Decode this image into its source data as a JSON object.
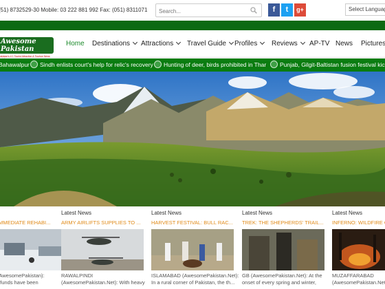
{
  "topbar": {
    "contact": "(51) 8732529-30 Mobile: 03 222 881 992 Fax: (051) 8311071",
    "search_placeholder": "Search...",
    "social": {
      "facebook": "f",
      "twitter": "t",
      "googleplus": "g+"
    },
    "language": "Select Language"
  },
  "logo": {
    "brand": "Awesome Pakistan",
    "tagline": "Pakistan's # 1 Tourist Attraction & Tourism News Portal"
  },
  "nav": {
    "home": "Home",
    "destinations": "Destinations",
    "attractions": "Attractions",
    "travel_guide": "Travel Guide",
    "profiles": "Profiles",
    "reviews": "Reviews",
    "aptv": "AP-TV",
    "news": "News",
    "pictures": "Pictures"
  },
  "ticker": [
    "Bahawalpur",
    "Sindh enlists court's help for relic's recovery",
    "Hunting of deer, birds prohibited in Thar",
    "Punjab, Gilgit-Baltistan fusion festival kicks off"
  ],
  "cards": [
    {
      "label": "",
      "headline": "IMMEDIATE REHABI...",
      "place": "(AwesomePakistan):",
      "snippet": "f funds have been"
    },
    {
      "label": "Latest News",
      "headline": "ARMY AIRLIFTS SUPPLIES TO ...",
      "place": "RAWALPINDI",
      "snippet": "(AwesomePakistan.Net): With heavy"
    },
    {
      "label": "Latest News",
      "headline": "HARVEST FESTIVAL: BULL RAC...",
      "place": "ISLAMABAD (AwesomePakistan.Net):",
      "snippet": "In a rural corner of Pakistan, the th..."
    },
    {
      "label": "Latest News",
      "headline": "TREK: THE SHEPHERDS' TRAIL...",
      "place": "GB (AwesomePakistan.Net): At the",
      "snippet": "onset of every spring and winter,"
    },
    {
      "label": "Latest News",
      "headline": "INFERNO: WILDFIRE GU...",
      "place": "MUZAFFARABAD",
      "snippet": "(AwesomePakistan.Net):"
    }
  ],
  "colors": {
    "green": "#0a7c10",
    "orange": "#e08a18",
    "nav_active": "#1d8a2c"
  }
}
